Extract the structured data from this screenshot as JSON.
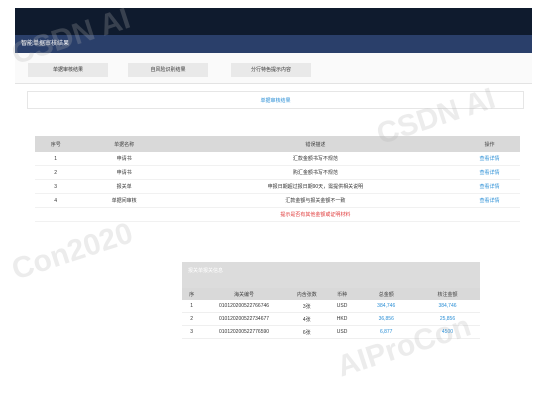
{
  "title": "智能单据审核结果",
  "tabs": [
    "单据审核结果",
    "自风险识别结果",
    "分行特色提示内容"
  ],
  "section_title": "单据审核结果",
  "results_table": {
    "headers": [
      "序号",
      "单据名称",
      "错误描述",
      "操作"
    ],
    "rows": [
      {
        "no": "1",
        "name": "申请书",
        "desc": "汇款金额书写不规范",
        "action": "查看详情"
      },
      {
        "no": "2",
        "name": "申请书",
        "desc": "购汇金额书写不规范",
        "action": "查看详情"
      },
      {
        "no": "3",
        "name": "报关单",
        "desc": "申报日期超过报日期90天，需提供相关说明",
        "action": "查看详情"
      },
      {
        "no": "4",
        "name": "单据间审核",
        "desc": "汇款金额与报关金额不一致",
        "action": "查看详情"
      }
    ],
    "warning": "提示是否有其他金额或证明材料"
  },
  "detail_title": "报关单报关信息",
  "detail_table": {
    "headers": [
      "序",
      "海关编号",
      "内含张数",
      "币种",
      "总金额",
      "核注金额"
    ],
    "rows": [
      {
        "no": "1",
        "code": "010120200522766746",
        "count": "3张",
        "cur": "USD",
        "total": "384,746",
        "verified": "384,746"
      },
      {
        "no": "2",
        "code": "010120200522734677",
        "count": "4张",
        "cur": "HKD",
        "total": "36,856",
        "verified": "25,856"
      },
      {
        "no": "3",
        "code": "010120200522776590",
        "count": "6张",
        "cur": "USD",
        "total": "6,877",
        "verified": "4500"
      }
    ]
  },
  "watermarks": [
    "CSDN AI",
    "Con2020",
    "AIProCon",
    "CSDN AI"
  ]
}
